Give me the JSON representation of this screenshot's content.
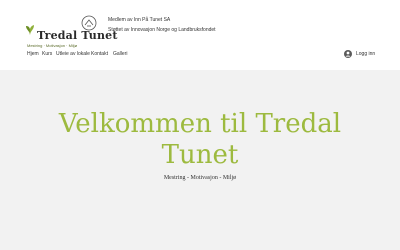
{
  "logo": {
    "title": "Tredal Tunet",
    "tagline": "Mestring · Motivasjon · Miljø"
  },
  "header": {
    "member_line": "Medlem av Inn På Tunet SA",
    "support_line": "Støttet av Innovasjon Norge og Landbruksfondet"
  },
  "nav": {
    "items": [
      {
        "label": "Hjem"
      },
      {
        "label": "Kurs"
      },
      {
        "label": "Utleie av lokale"
      },
      {
        "label": "Kontakt"
      },
      {
        "label": "Galleri"
      }
    ]
  },
  "login": {
    "label": "Logg inn",
    "icon": "user-avatar-icon"
  },
  "hero": {
    "title": "Velkommen til Tredal Tunet",
    "subtitle": "Mestring - Motivasjon - Miljø"
  },
  "colors": {
    "accent": "#9dba3f",
    "hero_bg": "#f2f2f2",
    "text": "#333333"
  }
}
